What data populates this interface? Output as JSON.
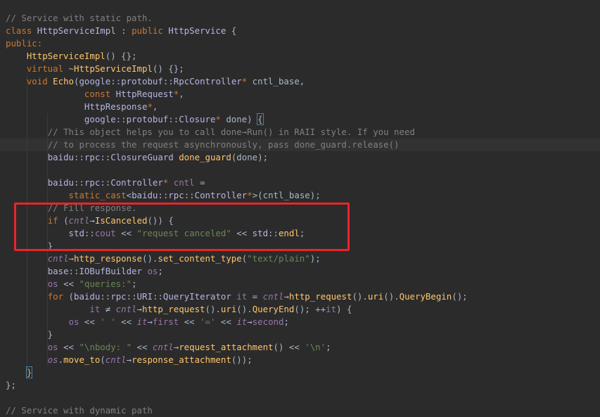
{
  "editor": {
    "lines": [
      [
        [
          "comment",
          "// Service with static path."
        ]
      ],
      [
        [
          "keyword",
          "class "
        ],
        [
          "type",
          "HttpServiceImpl"
        ],
        [
          "plain",
          " : "
        ],
        [
          "keyword",
          "public "
        ],
        [
          "type",
          "HttpService"
        ],
        [
          "plain",
          " {"
        ]
      ],
      [
        [
          "keyword",
          "public:"
        ]
      ],
      [
        [
          "plain",
          "    "
        ],
        [
          "func",
          "HttpServiceImpl"
        ],
        [
          "plain",
          "() {};"
        ]
      ],
      [
        [
          "plain",
          "    "
        ],
        [
          "keyword",
          "virtual "
        ],
        [
          "plain",
          "~"
        ],
        [
          "func",
          "HttpServiceImpl"
        ],
        [
          "plain",
          "() {};"
        ]
      ],
      [
        [
          "plain",
          "    "
        ],
        [
          "keyword",
          "void "
        ],
        [
          "func",
          "Echo"
        ],
        [
          "plain",
          "("
        ],
        [
          "ns",
          "google"
        ],
        [
          "plain",
          "::"
        ],
        [
          "ns",
          "protobuf"
        ],
        [
          "plain",
          "::"
        ],
        [
          "type",
          "RpcController"
        ],
        [
          "keyword",
          "* "
        ],
        [
          "plain",
          "cntl_base,"
        ]
      ],
      [
        [
          "plain",
          "               "
        ],
        [
          "keyword",
          "const "
        ],
        [
          "type",
          "HttpRequest"
        ],
        [
          "keyword",
          "*"
        ],
        [
          "plain",
          ","
        ]
      ],
      [
        [
          "plain",
          "               "
        ],
        [
          "type",
          "HttpResponse"
        ],
        [
          "keyword",
          "*"
        ],
        [
          "plain",
          ","
        ]
      ],
      [
        [
          "plain",
          "               "
        ],
        [
          "ns",
          "google"
        ],
        [
          "plain",
          "::"
        ],
        [
          "ns",
          "protobuf"
        ],
        [
          "plain",
          "::"
        ],
        [
          "type",
          "Closure"
        ],
        [
          "keyword",
          "* "
        ],
        [
          "plain",
          "done) "
        ],
        [
          "bracehl",
          "{"
        ]
      ],
      [
        [
          "plain",
          "        "
        ],
        [
          "comment",
          "// This object helps you to call done→Run() in RAII style. If you need"
        ]
      ],
      [
        [
          "plain",
          "        "
        ],
        [
          "comment",
          "// to process the request asynchronously, pass done_guard.release()"
        ]
      ],
      [
        [
          "plain",
          "        "
        ],
        [
          "ns",
          "baidu"
        ],
        [
          "plain",
          "::"
        ],
        [
          "ns",
          "rpc"
        ],
        [
          "plain",
          "::"
        ],
        [
          "type",
          "ClosureGuard "
        ],
        [
          "func",
          "done_guard"
        ],
        [
          "plain",
          "(done);"
        ]
      ],
      [
        [
          "plain",
          ""
        ]
      ],
      [
        [
          "plain",
          "        "
        ],
        [
          "ns",
          "baidu"
        ],
        [
          "plain",
          "::"
        ],
        [
          "ns",
          "rpc"
        ],
        [
          "plain",
          "::"
        ],
        [
          "type",
          "Controller"
        ],
        [
          "keyword",
          "* "
        ],
        [
          "field",
          "cntl"
        ],
        [
          "plain",
          " ="
        ]
      ],
      [
        [
          "plain",
          "            "
        ],
        [
          "keyword",
          "static_cast"
        ],
        [
          "plain",
          "<"
        ],
        [
          "ns",
          "baidu"
        ],
        [
          "plain",
          "::"
        ],
        [
          "ns",
          "rpc"
        ],
        [
          "plain",
          "::"
        ],
        [
          "type",
          "Controller"
        ],
        [
          "keyword",
          "*"
        ],
        [
          "plain",
          ">(cntl_base);"
        ]
      ],
      [
        [
          "plain",
          "        "
        ],
        [
          "comment",
          "// Fill response."
        ]
      ],
      [
        [
          "plain",
          "        "
        ],
        [
          "keyword",
          "if "
        ],
        [
          "plain",
          "("
        ],
        [
          "var",
          "cntl"
        ],
        [
          "plain",
          "→"
        ],
        [
          "func",
          "IsCanceled"
        ],
        [
          "plain",
          "()) {"
        ]
      ],
      [
        [
          "plain",
          "            "
        ],
        [
          "ns",
          "std"
        ],
        [
          "plain",
          "::"
        ],
        [
          "field",
          "cout"
        ],
        [
          "plain",
          " << "
        ],
        [
          "string",
          "\"request canceled\""
        ],
        [
          "plain",
          " << "
        ],
        [
          "ns",
          "std"
        ],
        [
          "plain",
          "::"
        ],
        [
          "func",
          "endl"
        ],
        [
          "plain",
          ";"
        ]
      ],
      [
        [
          "plain",
          "        }"
        ]
      ],
      [
        [
          "plain",
          "        "
        ],
        [
          "var",
          "cntl"
        ],
        [
          "plain",
          "→"
        ],
        [
          "func",
          "http_response"
        ],
        [
          "plain",
          "()."
        ],
        [
          "func",
          "set_content_type"
        ],
        [
          "plain",
          "("
        ],
        [
          "string",
          "\"text/plain\""
        ],
        [
          "plain",
          ");"
        ]
      ],
      [
        [
          "plain",
          "        "
        ],
        [
          "ns",
          "base"
        ],
        [
          "plain",
          "::"
        ],
        [
          "type",
          "IOBufBuilder "
        ],
        [
          "field",
          "os"
        ],
        [
          "plain",
          ";"
        ]
      ],
      [
        [
          "plain",
          "        "
        ],
        [
          "field",
          "os"
        ],
        [
          "plain",
          " << "
        ],
        [
          "string",
          "\"queries:\""
        ],
        [
          "plain",
          ";"
        ]
      ],
      [
        [
          "plain",
          "        "
        ],
        [
          "keyword",
          "for "
        ],
        [
          "plain",
          "("
        ],
        [
          "ns",
          "baidu"
        ],
        [
          "plain",
          "::"
        ],
        [
          "ns",
          "rpc"
        ],
        [
          "plain",
          "::"
        ],
        [
          "type",
          "URI"
        ],
        [
          "plain",
          "::"
        ],
        [
          "type",
          "QueryIterator "
        ],
        [
          "field",
          "it"
        ],
        [
          "plain",
          " = "
        ],
        [
          "var",
          "cntl"
        ],
        [
          "plain",
          "→"
        ],
        [
          "func",
          "http_request"
        ],
        [
          "plain",
          "()."
        ],
        [
          "func",
          "uri"
        ],
        [
          "plain",
          "()."
        ],
        [
          "func",
          "QueryBegin"
        ],
        [
          "plain",
          "();"
        ]
      ],
      [
        [
          "plain",
          "                "
        ],
        [
          "field",
          "it"
        ],
        [
          "plain",
          " ≠ "
        ],
        [
          "var",
          "cntl"
        ],
        [
          "plain",
          "→"
        ],
        [
          "func",
          "http_request"
        ],
        [
          "plain",
          "()."
        ],
        [
          "func",
          "uri"
        ],
        [
          "plain",
          "()."
        ],
        [
          "func",
          "QueryEnd"
        ],
        [
          "plain",
          "(); ++"
        ],
        [
          "field",
          "it"
        ],
        [
          "plain",
          ") {"
        ]
      ],
      [
        [
          "plain",
          "            "
        ],
        [
          "field",
          "os"
        ],
        [
          "plain",
          " << "
        ],
        [
          "string",
          "' '"
        ],
        [
          "plain",
          " << "
        ],
        [
          "var",
          "it"
        ],
        [
          "plain",
          "→"
        ],
        [
          "field",
          "first"
        ],
        [
          "plain",
          " << "
        ],
        [
          "string",
          "'='"
        ],
        [
          "plain",
          " << "
        ],
        [
          "var",
          "it"
        ],
        [
          "plain",
          "→"
        ],
        [
          "field",
          "second"
        ],
        [
          "plain",
          ";"
        ]
      ],
      [
        [
          "plain",
          "        }"
        ]
      ],
      [
        [
          "plain",
          "        "
        ],
        [
          "field",
          "os"
        ],
        [
          "plain",
          " << "
        ],
        [
          "string",
          "\"\\nbody: \""
        ],
        [
          "plain",
          " << "
        ],
        [
          "var",
          "cntl"
        ],
        [
          "plain",
          "→"
        ],
        [
          "func",
          "request_attachment"
        ],
        [
          "plain",
          "() << "
        ],
        [
          "string",
          "'\\n'"
        ],
        [
          "plain",
          ";"
        ]
      ],
      [
        [
          "plain",
          "        "
        ],
        [
          "var",
          "os"
        ],
        [
          "plain",
          "."
        ],
        [
          "func",
          "move_to"
        ],
        [
          "plain",
          "("
        ],
        [
          "var",
          "cntl"
        ],
        [
          "plain",
          "→"
        ],
        [
          "func",
          "response_attachment"
        ],
        [
          "plain",
          "());"
        ]
      ],
      [
        [
          "plain",
          "    "
        ],
        [
          "bracehl",
          "}"
        ]
      ],
      [
        [
          "plain",
          "};"
        ]
      ],
      [
        [
          "plain",
          ""
        ]
      ],
      [
        [
          "comment",
          "// Service with dynamic path"
        ]
      ]
    ],
    "highlighted_line_index": 10,
    "highlight_box_line_range": [
      15,
      18
    ],
    "colors": {
      "background": "#2b2b2b",
      "annotation_box": "#e8252a"
    }
  }
}
